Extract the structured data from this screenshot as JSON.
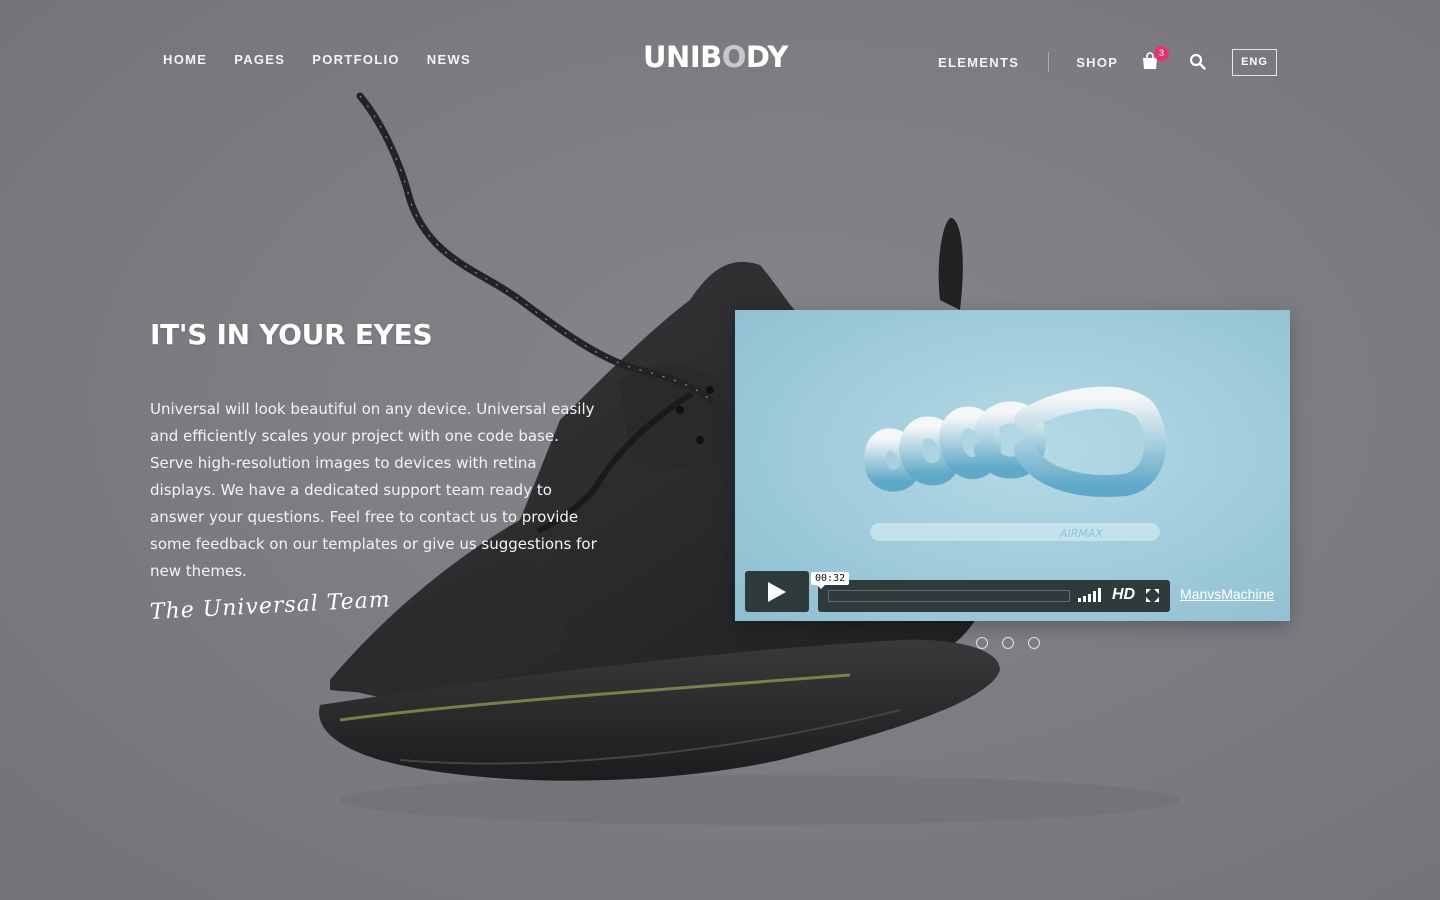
{
  "nav": {
    "left": [
      "HOME",
      "PAGES",
      "PORTFOLIO",
      "NEWS"
    ],
    "logo": "UNIBODY",
    "right": [
      "ELEMENTS",
      "SHOP"
    ],
    "cart_count": "3",
    "language": "ENG"
  },
  "hero": {
    "headline": "IT'S IN YOUR EYES",
    "body": "Universal will look beautiful on any device. Universal easily and efficiently scales your project with one code base. Serve high-resolution images to devices with retina displays. We have a dedicated support team ready to answer your questions. Feel free to contact us to provide some feedback on our templates or give us suggestions for new themes.",
    "signature": "The Universal Team"
  },
  "video": {
    "time": "00:32",
    "hd_label": "HD",
    "credit": "ManvsMachine",
    "product_text": "AIRMAX"
  },
  "slider": {
    "dots": 3,
    "active": 0
  },
  "colors": {
    "badge": "#e8326d",
    "background": "#7d7d82",
    "video_bg": "#a4cfdd"
  }
}
